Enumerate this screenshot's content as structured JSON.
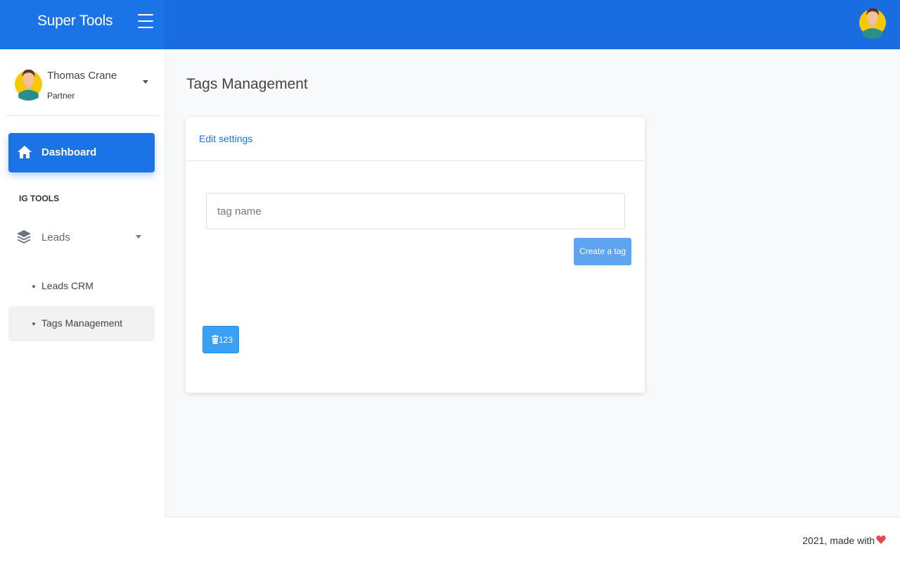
{
  "header": {
    "brand": "Super Tools",
    "menu_icon": "hamburger-icon",
    "avatar_icon": "user-avatar-icon",
    "colors": {
      "brand": "#1b73e6",
      "topbar": "#1a6de0"
    }
  },
  "sidebar": {
    "user": {
      "name": "Thomas Crane",
      "role": "Partner"
    },
    "dashboard": {
      "label": "Dashboard",
      "icon": "home-icon"
    },
    "section_label": "IG TOOLS",
    "leads": {
      "label": "Leads",
      "icon": "layers-icon"
    },
    "sub_items": [
      {
        "label": "Leads CRM",
        "active": false
      },
      {
        "label": "Tags Management",
        "active": true
      }
    ]
  },
  "main": {
    "page_title": "Tags Management",
    "card": {
      "title": "Edit settings",
      "input_placeholder": "tag name",
      "input_value": "",
      "create_button": "Create a tag",
      "tags": [
        {
          "label": "123",
          "icon": "trash-icon"
        }
      ]
    }
  },
  "footer": {
    "text": "2021, made with",
    "icon": "heart-icon",
    "heart_color": "#e8474b"
  }
}
